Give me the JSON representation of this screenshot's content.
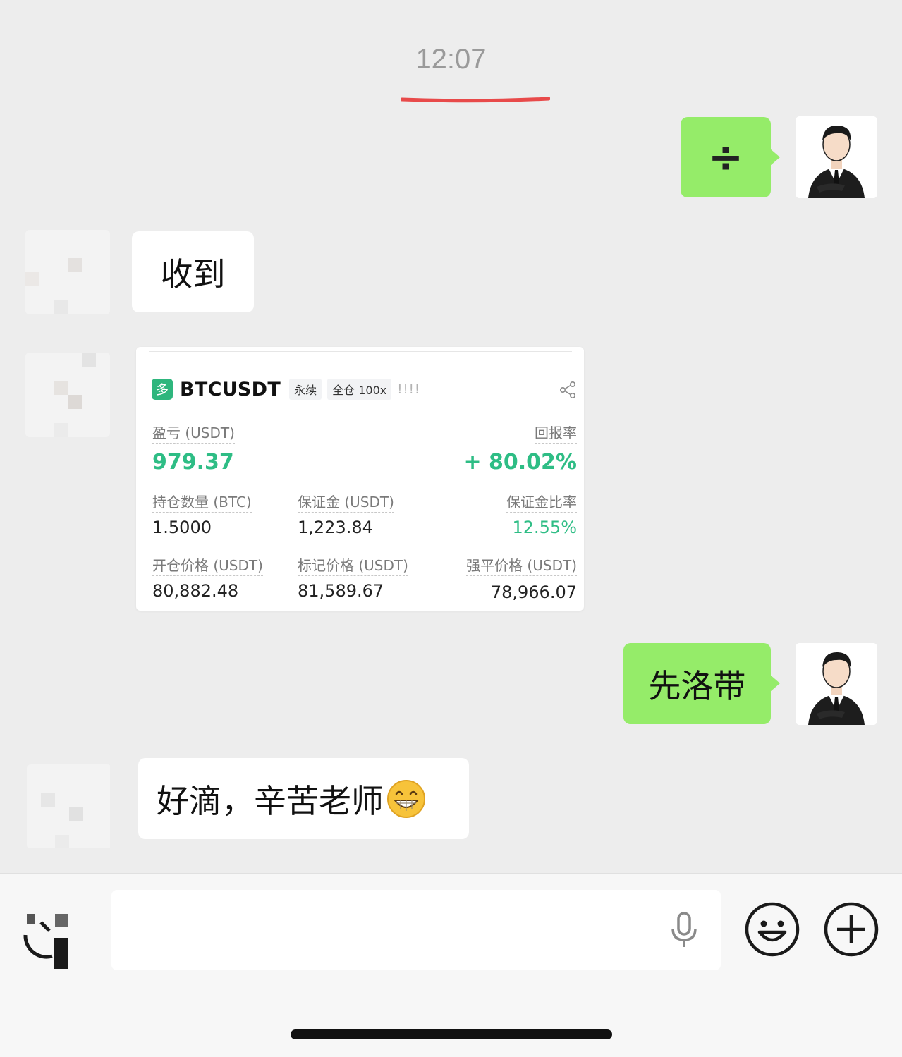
{
  "chat": {
    "timestamp": "12:07",
    "colors": {
      "background": "#ededed",
      "outgoing_bubble": "#95ec69",
      "incoming_bubble": "#ffffff",
      "accent_underline": "#e84a4a",
      "profit_green": "#2ebd85"
    },
    "messages": [
      {
        "side": "outgoing",
        "text": "÷"
      },
      {
        "side": "incoming",
        "text": "收到"
      },
      {
        "side": "incoming",
        "type": "position-card"
      },
      {
        "side": "outgoing",
        "text": "先洛带"
      },
      {
        "side": "incoming",
        "text": "好滴，辛苦老师",
        "emoji": "grinning-face-icon"
      }
    ]
  },
  "card": {
    "badge": "多",
    "symbol": "BTCUSDT",
    "tag_type": "永续",
    "tag_margin": "全仓 100x",
    "bangs": "!!!!",
    "pnl_label": "盈亏 (USDT)",
    "pnl_value": "979.37",
    "roe_label": "回报率",
    "roe_value": "+ 80.02%",
    "size_label": "持仓数量 (BTC)",
    "size_value": "1.5000",
    "margin_label": "保证金 (USDT)",
    "margin_value": "1,223.84",
    "margin_ratio_label": "保证金比率",
    "margin_ratio_value": "12.55%",
    "entry_label": "开仓价格 (USDT)",
    "entry_value": "80,882.48",
    "mark_label": "标记价格 (USDT)",
    "mark_value": "81,589.67",
    "liq_label": "强平价格 (USDT)",
    "liq_value": "78,966.07"
  },
  "inputbar": {
    "voice_icon": "voice-toggle-icon",
    "mic_icon": "microphone-icon",
    "emoji_icon": "emoji-icon",
    "plus_icon": "plus-circle-icon"
  }
}
